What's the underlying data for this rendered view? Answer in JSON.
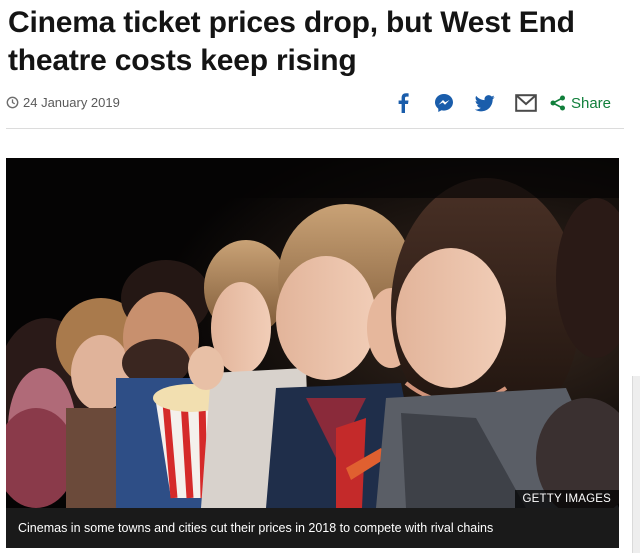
{
  "article": {
    "headline": "Cinema ticket prices drop, but West End theatre costs keep rising",
    "date": "24 January 2019"
  },
  "share": {
    "label": "Share",
    "buttons": [
      "facebook-icon",
      "messenger-icon",
      "twitter-icon",
      "email-icon"
    ],
    "icon_color": "#1a5dab",
    "label_color": "#117f3b"
  },
  "image": {
    "credit": "GETTY IMAGES",
    "caption": "Cinemas in some towns and cities cut their prices in 2018 to compete with rival chains"
  }
}
